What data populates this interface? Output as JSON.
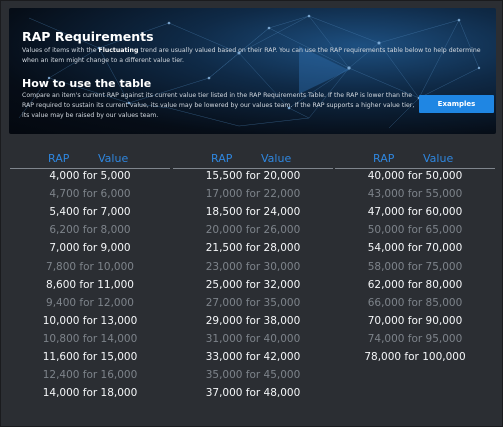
{
  "banner": {
    "title": "RAP Requirements",
    "para1_before": "Values of items with the ",
    "para1_bold": "Fluctuating",
    "para1_after": " trend are usually valued based on their RAP. You can use the RAP requirements table below to help determine when an item might change to a different value tier.",
    "subtitle": "How to use the table",
    "para2": "Compare an item's current RAP against its current value tier listed in the RAP Requirements Table. If the RAP is lower than the RAP required to sustain its current value, its value may be lowered by our values team. If the RAP supports a higher value tier, its value may be raised by our values team.",
    "button_label": "Examples"
  },
  "headers": {
    "rap": "RAP",
    "value": "Value"
  },
  "columns": [
    [
      "4,000 for 5,000",
      "4,700 for 6,000",
      "5,400 for 7,000",
      "6,200 for 8,000",
      "7,000 for 9,000",
      "7,800 for 10,000",
      "8,600 for 11,000",
      "9,400 for 12,000",
      "10,000 for 13,000",
      "10,800 for 14,000",
      "11,600 for 15,000",
      "12,400 for 16,000",
      "14,000 for 18,000"
    ],
    [
      "15,500 for 20,000",
      "17,000 for 22,000",
      "18,500 for 24,000",
      "20,000 for 26,000",
      "21,500 for 28,000",
      "23,000 for 30,000",
      "25,000 for 32,000",
      "27,000 for 35,000",
      "29,000 for 38,000",
      "31,000 for 40,000",
      "33,000 for 42,000",
      "35,000 for 45,000",
      "37,000 for 48,000"
    ],
    [
      "40,000 for 50,000",
      "43,000 for 55,000",
      "47,000 for 60,000",
      "50,000 for 65,000",
      "54,000 for 70,000",
      "58,000 for 75,000",
      "62,000 for 80,000",
      "66,000 for 85,000",
      "70,000 for 90,000",
      "74,000 for 95,000",
      "78,000 for 100,000"
    ]
  ]
}
